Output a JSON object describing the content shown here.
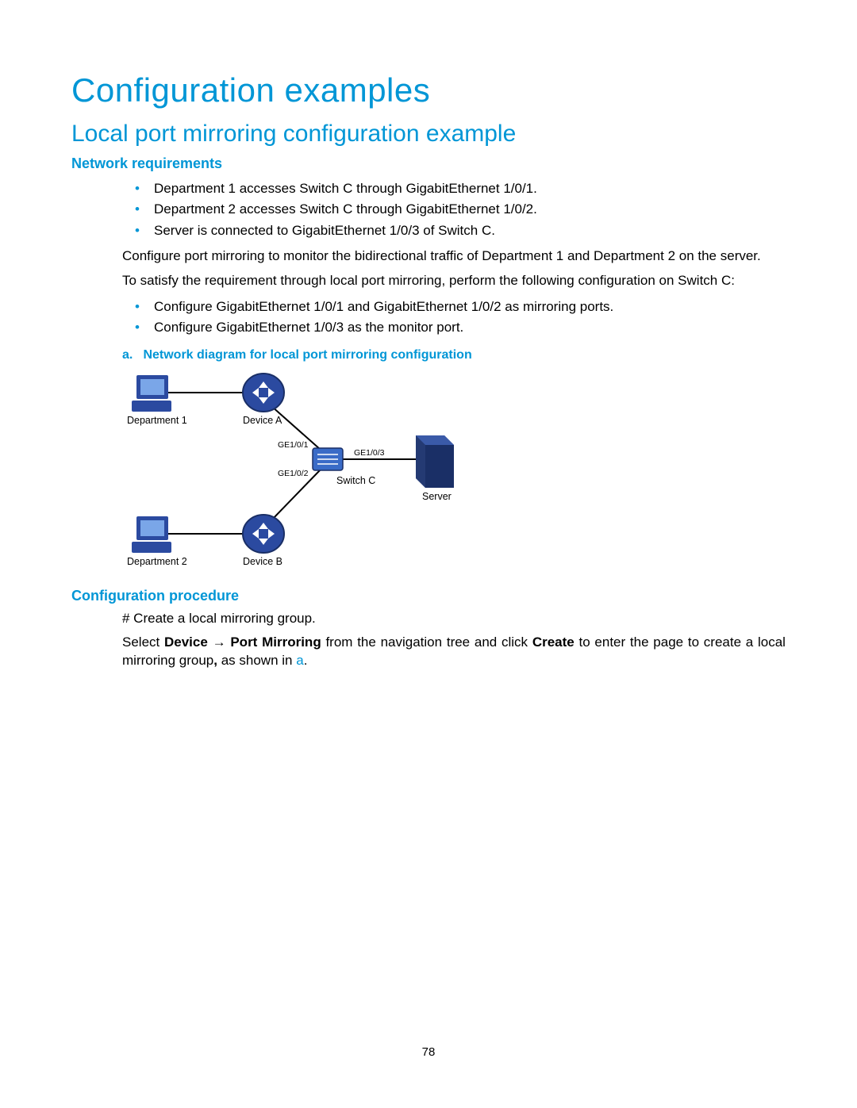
{
  "title": "Configuration examples",
  "subtitle": "Local port mirroring configuration example",
  "section_net_req": "Network requirements",
  "req_bullets_1": [
    "Department 1 accesses Switch C through GigabitEthernet 1/0/1.",
    "Department 2 accesses Switch C through GigabitEthernet 1/0/2.",
    "Server is connected to GigabitEthernet 1/0/3 of Switch C."
  ],
  "para_configure": "Configure port mirroring to monitor the bidirectional traffic of Department 1 and Department 2 on the server.",
  "para_satisfy": "To satisfy the requirement through local port mirroring, perform the following configuration on Switch C:",
  "req_bullets_2": [
    "Configure GigabitEthernet 1/0/1 and GigabitEthernet 1/0/2 as mirroring ports.",
    "Configure GigabitEthernet 1/0/3 as the monitor port."
  ],
  "fig_caption_label": "a.",
  "fig_caption_text": "Network diagram for local port mirroring configuration",
  "diagram": {
    "dept1": "Department 1",
    "dept2": "Department 2",
    "devA": "Device A",
    "devB": "Device B",
    "switchC": "Switch C",
    "server": "Server",
    "ge1": "GE1/0/1",
    "ge2": "GE1/0/2",
    "ge3": "GE1/0/3"
  },
  "section_proc": "Configuration procedure",
  "proc_hash": "# Create a local mirroring group.",
  "proc_select_1": "Select ",
  "proc_select_device": "Device",
  "proc_select_arrow": " → ",
  "proc_select_pm": "Port Mirroring",
  "proc_select_2": " from the navigation tree and click ",
  "proc_select_create": "Create",
  "proc_select_3": " to enter the page to create a local mirroring group",
  "proc_select_comma": ",",
  "proc_select_4": " as shown in ",
  "proc_select_a": "a",
  "proc_select_5": ".",
  "page_number": "78"
}
